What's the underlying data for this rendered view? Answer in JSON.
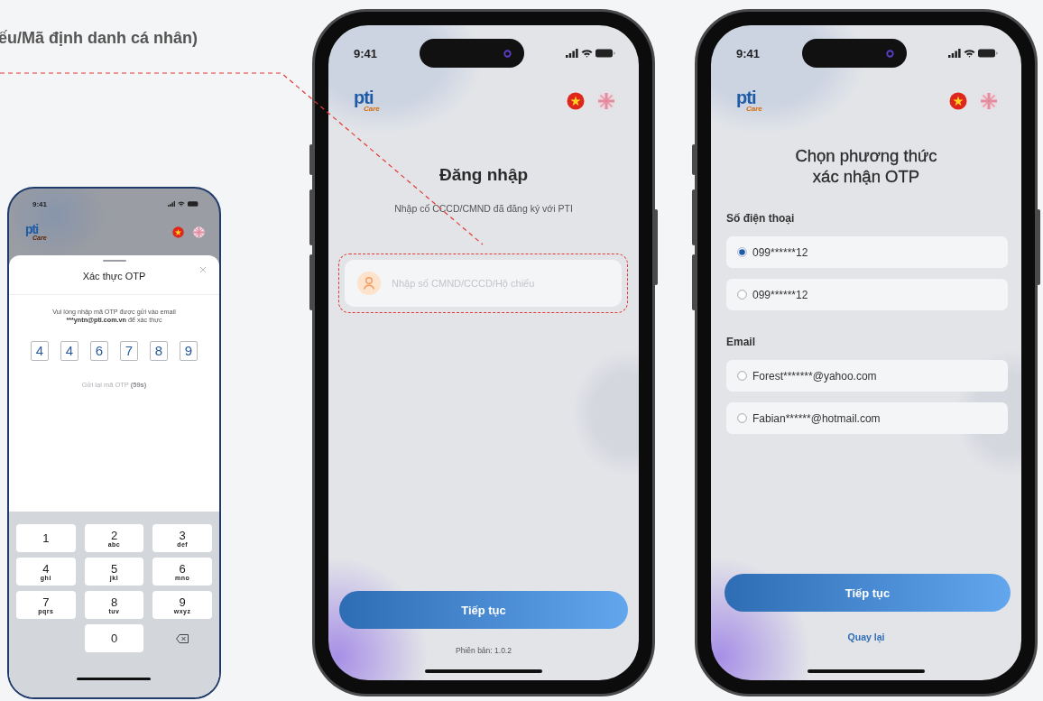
{
  "annotation": {
    "text": "ếu/Mã định danh cá nhân)"
  },
  "otp_screen": {
    "status_time": "9:41",
    "logo": "pti",
    "logo_sub": "Care",
    "sheet": {
      "title": "Xác thực OTP",
      "message": "Vui lòng nhập mã OTP được gửi vào email",
      "email": "***yntn@pti.com.vn",
      "message_end": "để xác thực",
      "digits": [
        "4",
        "4",
        "6",
        "7",
        "8",
        "9"
      ],
      "resend": "Gửi lại mã OTP",
      "countdown": "(59s)"
    },
    "keypad": [
      {
        "kind": "digit",
        "digit": "1"
      },
      {
        "kind": "digit",
        "digit": "2",
        "letters": "abc"
      },
      {
        "kind": "digit",
        "digit": "3",
        "letters": "def"
      },
      {
        "kind": "digit",
        "digit": "4",
        "letters": "ghi"
      },
      {
        "kind": "digit",
        "digit": "5",
        "letters": "jkl"
      },
      {
        "kind": "digit",
        "digit": "6",
        "letters": "mno"
      },
      {
        "kind": "digit",
        "digit": "7",
        "letters": "pqrs"
      },
      {
        "kind": "digit",
        "digit": "8",
        "letters": "tuv"
      },
      {
        "kind": "digit",
        "digit": "9",
        "letters": "wxyz"
      },
      {
        "kind": "digit",
        "digit": "0"
      },
      {
        "kind": "backspace"
      }
    ]
  },
  "login_screen": {
    "status_time": "9:41",
    "logo": "pti",
    "logo_sub": "Care",
    "title": "Đăng nhập",
    "subtitle": "Nhập cố CCCD/CMND đã đăng ký với PTI",
    "input": {
      "placeholder": "Nhập số CMND/CCCD/Hộ chiếu",
      "highlighted": true
    },
    "button": "Tiếp tục",
    "version": "Phiên bản: 1.0.2"
  },
  "otp_method_screen": {
    "status_time": "9:41",
    "logo": "pti",
    "logo_sub": "Care",
    "title": "Chọn phương thức xác nhận OTP",
    "groups": [
      {
        "label": "Số điện thoại",
        "options": [
          {
            "label": "099******12",
            "selected": true
          },
          {
            "label": "099******12",
            "selected": false
          }
        ]
      },
      {
        "label": "Email",
        "options": [
          {
            "label": "Forest*******@yahoo.com",
            "selected": false
          },
          {
            "label": "Fabian******@hotmail.com",
            "selected": false
          }
        ]
      }
    ],
    "button": "Tiếp tục",
    "back_link": "Quay lại"
  }
}
